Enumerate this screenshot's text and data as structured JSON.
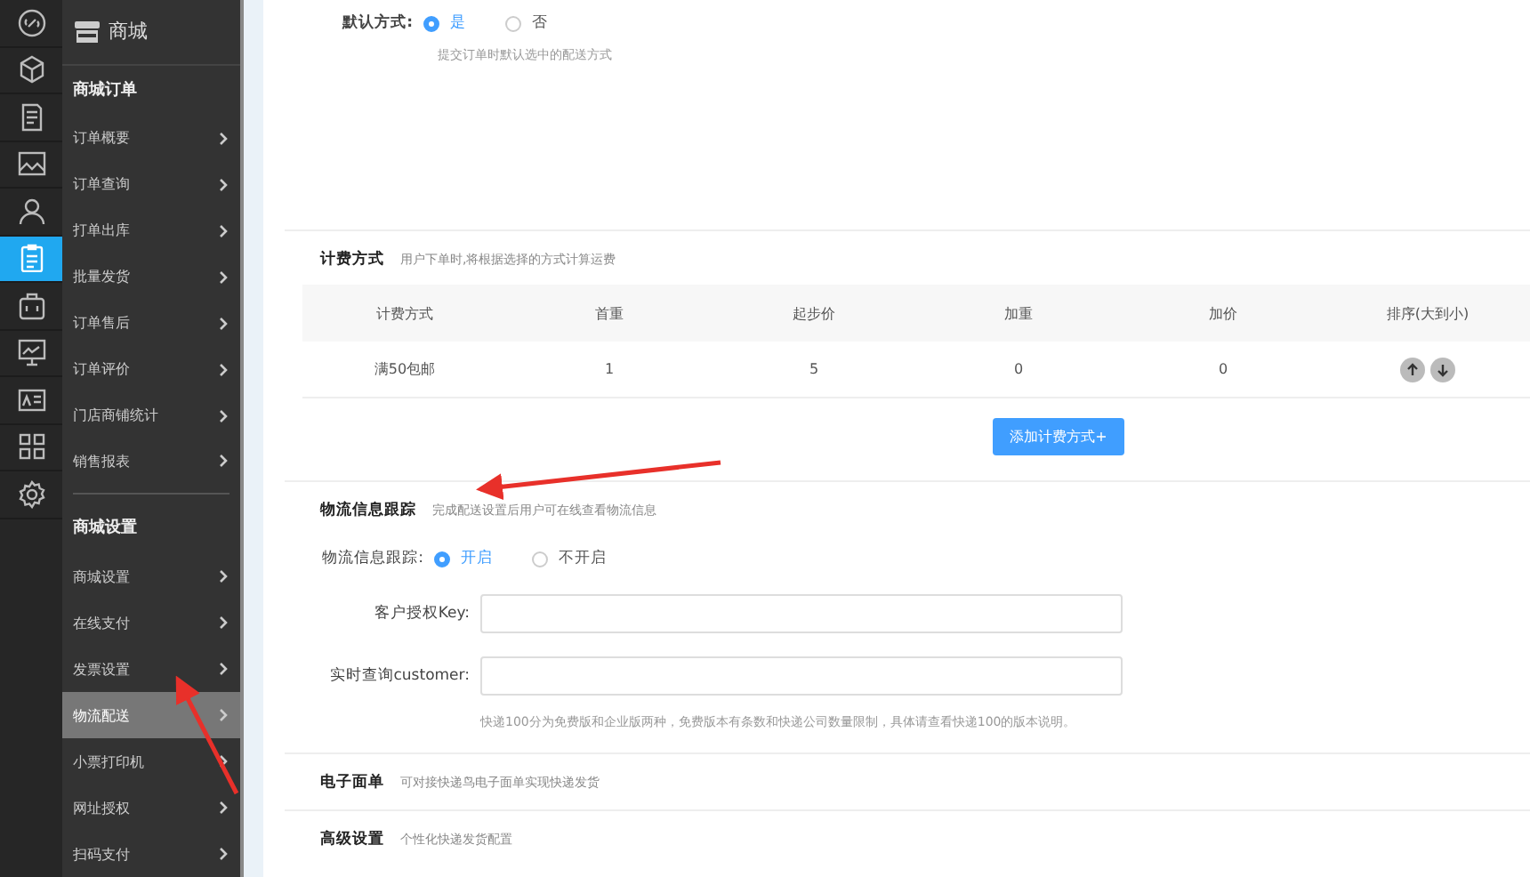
{
  "rail": [
    {
      "kind": "link",
      "selected": false
    },
    {
      "kind": "cube",
      "selected": false
    },
    {
      "kind": "document",
      "selected": false
    },
    {
      "kind": "image",
      "selected": false
    },
    {
      "kind": "user",
      "selected": false
    },
    {
      "kind": "clipboard",
      "selected": true
    },
    {
      "kind": "briefcase",
      "selected": false
    },
    {
      "kind": "monitor",
      "selected": false
    },
    {
      "kind": "card",
      "selected": false
    },
    {
      "kind": "grid",
      "selected": false
    },
    {
      "kind": "gear",
      "selected": false
    }
  ],
  "submenu": {
    "title": "商城",
    "groups": [
      {
        "title": "商城订单",
        "items": [
          {
            "label": "订单概要",
            "selected": false
          },
          {
            "label": "订单查询",
            "selected": false
          },
          {
            "label": "打单出库",
            "selected": false
          },
          {
            "label": "批量发货",
            "selected": false
          },
          {
            "label": "订单售后",
            "selected": false
          },
          {
            "label": "订单评价",
            "selected": false
          },
          {
            "label": "门店商铺统计",
            "selected": false
          },
          {
            "label": "销售报表",
            "selected": false
          }
        ]
      },
      {
        "title": "商城设置",
        "items": [
          {
            "label": "商城设置",
            "selected": false
          },
          {
            "label": "在线支付",
            "selected": false
          },
          {
            "label": "发票设置",
            "selected": false
          },
          {
            "label": "物流配送",
            "selected": true
          },
          {
            "label": "小票打印机",
            "selected": false
          },
          {
            "label": "网址授权",
            "selected": false
          },
          {
            "label": "扫码支付",
            "selected": false
          }
        ]
      }
    ]
  },
  "default_method": {
    "label": "默认方式:",
    "options": [
      {
        "label": "是",
        "selected": true
      },
      {
        "label": "否",
        "selected": false
      }
    ],
    "hint": "提交订单时默认选中的配送方式"
  },
  "billing": {
    "title": "计费方式",
    "subtitle": "用户下单时,将根据选择的方式计算运费",
    "table": {
      "columns": [
        "计费方式",
        "首重",
        "起步价",
        "加重",
        "加价",
        "排序(大到小)"
      ],
      "rows": [
        [
          "满50包邮",
          "1",
          "5",
          "0",
          "0"
        ]
      ]
    },
    "add_button": "添加计费方式+"
  },
  "tracking": {
    "title": "物流信息跟踪",
    "subtitle": "完成配送设置后用户可在线查看物流信息",
    "switch": {
      "label": "物流信息跟踪:",
      "options": [
        {
          "label": "开启",
          "selected": true
        },
        {
          "label": "不开启",
          "selected": false
        }
      ]
    },
    "fields": [
      {
        "label": "客户授权Key:"
      },
      {
        "label": "实时查询customer:"
      }
    ],
    "hint": "快递100分为免费版和企业版两种，免费版本有条数和快递公司数量限制，具体请查看快递100的版本说明。"
  },
  "sections": [
    {
      "title": "电子面单",
      "subtitle": "可对接快递鸟电子面单实现快递发货"
    },
    {
      "title": "高级设置",
      "subtitle": "个性化快递发货配置"
    }
  ]
}
